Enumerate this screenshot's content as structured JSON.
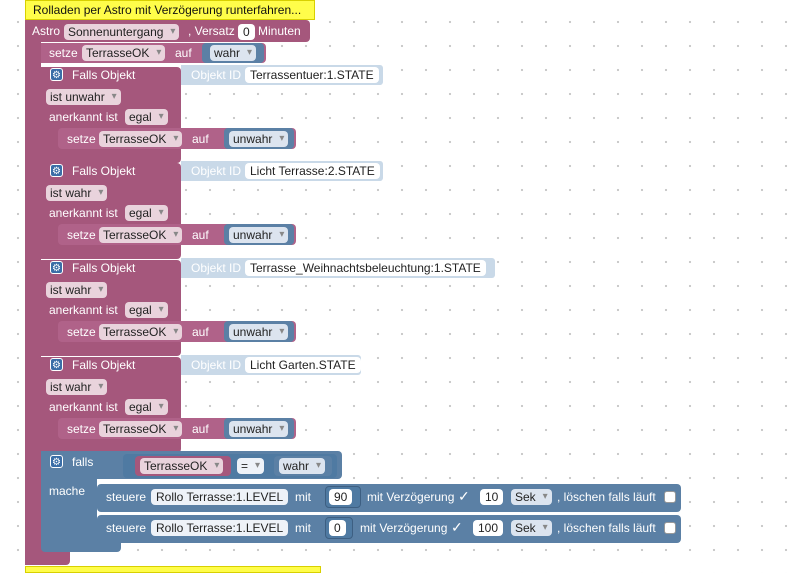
{
  "header": {
    "title": "Rolladen per Astro mit Verzögerung  runterfahren..."
  },
  "astro": {
    "label": "Astro",
    "event": "Sonnenuntergang",
    "offset_label": ", Versatz",
    "offset": "0",
    "unit": "Minuten"
  },
  "first_set": {
    "verb": "setze",
    "var": "TerrasseOK",
    "auf": "auf",
    "value": "wahr"
  },
  "blocks": [
    {
      "falls": "Falls Objekt",
      "oid_label": "Objekt ID",
      "oid": "Terrassentuer:1.STATE",
      "cond": "ist unwahr",
      "ack_label": "anerkannt ist",
      "ack": "egal",
      "set_verb": "setze",
      "set_var": "TerrasseOK",
      "set_auf": "auf",
      "set_val": "unwahr"
    },
    {
      "falls": "Falls Objekt",
      "oid_label": "Objekt ID",
      "oid": "Licht Terrasse:2.STATE",
      "cond": "ist wahr",
      "ack_label": "anerkannt ist",
      "ack": "egal",
      "set_verb": "setze",
      "set_var": "TerrasseOK",
      "set_auf": "auf",
      "set_val": "unwahr"
    },
    {
      "falls": "Falls Objekt",
      "oid_label": "Objekt ID",
      "oid": "Terrasse_Weihnachtsbeleuchtung:1.STATE",
      "cond": "ist wahr",
      "ack_label": "anerkannt ist",
      "ack": "egal",
      "set_verb": "setze",
      "set_var": "TerrasseOK",
      "set_auf": "auf",
      "set_val": "unwahr"
    },
    {
      "falls": "Falls Objekt",
      "oid_label": "Objekt ID",
      "oid": "Licht Garten.STATE",
      "cond": "ist wahr",
      "ack_label": "anerkannt ist",
      "ack": "egal",
      "set_verb": "setze",
      "set_var": "TerrasseOK",
      "set_auf": "auf",
      "set_val": "unwahr"
    }
  ],
  "if_block": {
    "falls": "falls",
    "var": "TerrasseOK",
    "op": "=",
    "value": "wahr",
    "mache": "mache",
    "actions": [
      {
        "steuere": "steuere",
        "device": "Rollo Terrasse:1.LEVEL",
        "mit": "mit",
        "value": "90",
        "delay_label": "mit Verzögerung",
        "delay": "10",
        "unit": "Sek",
        "clear_label": ", löschen falls läuft"
      },
      {
        "steuere": "steuere",
        "device": "Rollo Terrasse:1.LEVEL",
        "mit": "mit",
        "value": "0",
        "delay_label": "mit Verzögerung",
        "delay": "100",
        "unit": "Sek",
        "clear_label": ", löschen falls läuft"
      }
    ]
  },
  "colors": {
    "logic_pink": "#a5577c",
    "system_blue": "#5b80a5",
    "comment_yellow": "#fffd4a"
  }
}
